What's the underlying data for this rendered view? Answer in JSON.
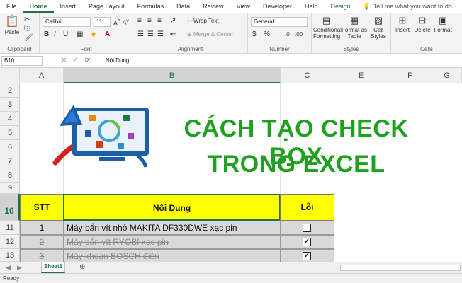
{
  "tabs": [
    "File",
    "Home",
    "Insert",
    "Page Layout",
    "Formulas",
    "Data",
    "Review",
    "View",
    "Developer",
    "Help",
    "Design"
  ],
  "active_tab": "Home",
  "tell_me": "Tell me what you want to do",
  "ribbon": {
    "paste": "Paste",
    "clipboard": "Clipboard",
    "font_name": "Calibri",
    "font_size": "11",
    "font": "Font",
    "wrap_text": "Wrap Text",
    "merge_center": "Merge & Center",
    "alignment": "Alignment",
    "number_format": "General",
    "number": "Number",
    "conditional_formatting": "Conditional Formatting",
    "format_as_table": "Format as Table",
    "cell_styles": "Cell Styles",
    "styles": "Styles",
    "insert": "Insert",
    "delete": "Delete",
    "format": "Format",
    "cells": "Cells"
  },
  "formula_bar": {
    "name_box": "B10",
    "fx": "fx",
    "content": "Nội Dung"
  },
  "columns": [
    "A",
    "B",
    "C",
    "E",
    "F",
    "G"
  ],
  "selected_column": "B",
  "rows": [
    "2",
    "3",
    "4",
    "5",
    "6",
    "7",
    "8",
    "9",
    "10",
    "11",
    "12",
    "13"
  ],
  "selected_row": "10",
  "title_line1": "CÁCH TẠO CHECK BOX",
  "title_line2": "TRONG EXCEL",
  "table": {
    "headers": [
      "STT",
      "Nội Dung",
      "Lỗi"
    ],
    "rows": [
      {
        "stt": "1",
        "content": "Máy bắn vít nhỏ MAKITA DF330DWE xạc pin",
        "checked": false
      },
      {
        "stt": "2",
        "content": "Máy bắn vít RYOBI xạc pin",
        "checked": true
      },
      {
        "stt": "3",
        "content": "Máy khoan BOSCH điện",
        "checked": true
      }
    ]
  },
  "sheet_tab": "Sheet1",
  "status": "Ready",
  "colors": {
    "accent": "#217346",
    "title": "#1ea11e",
    "header_fill": "#ffff00"
  }
}
